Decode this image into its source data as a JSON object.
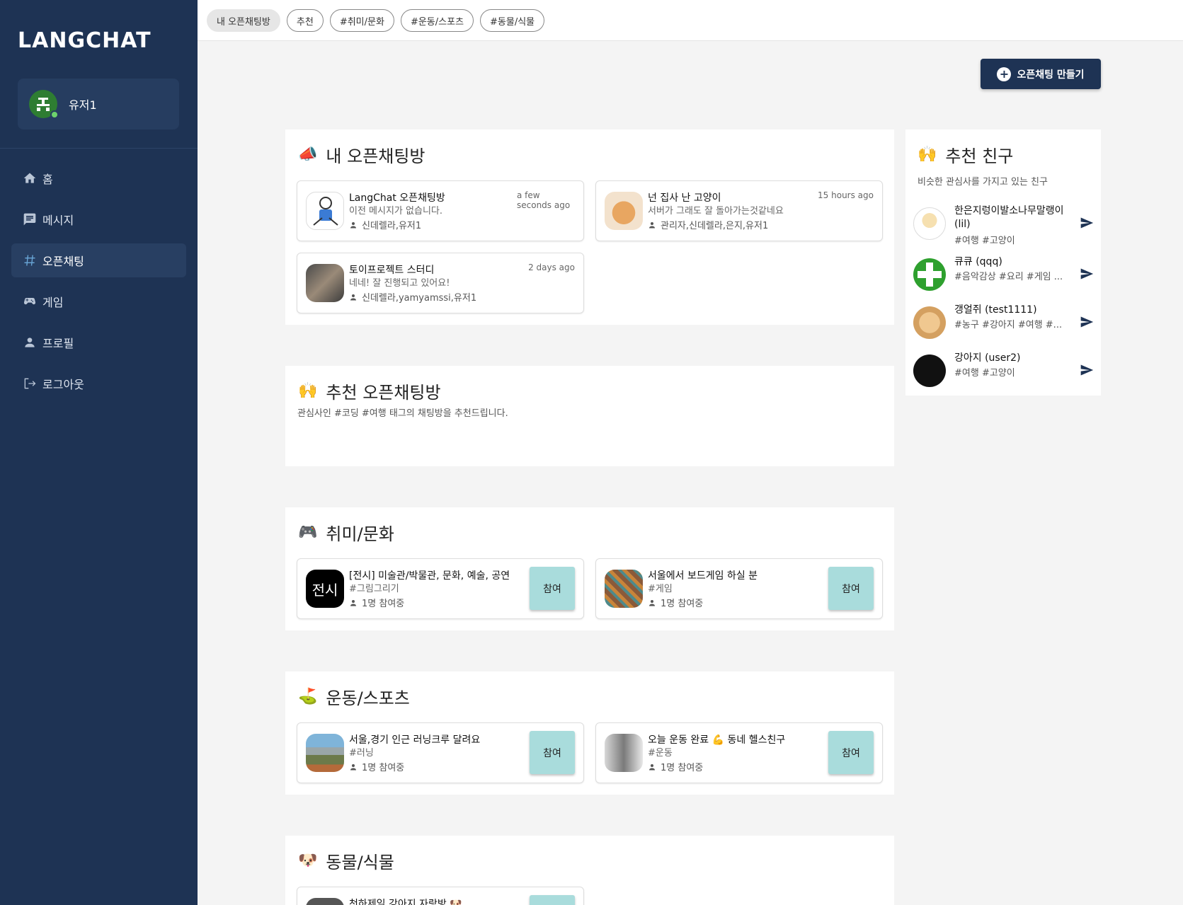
{
  "app": {
    "logo": "LANGCHAT"
  },
  "user": {
    "name": "유저1"
  },
  "nav": [
    {
      "icon": "home-icon",
      "label": "홈"
    },
    {
      "icon": "message-icon",
      "label": "메시지"
    },
    {
      "icon": "hash-icon",
      "label": "오픈채팅",
      "active": true
    },
    {
      "icon": "gamepad-icon",
      "label": "게임"
    },
    {
      "icon": "person-icon",
      "label": "프로필"
    },
    {
      "icon": "logout-icon",
      "label": "로그아웃"
    }
  ],
  "tags": [
    "내 오픈채팅방",
    "추천",
    "#취미/문화",
    "#운동/스포츠",
    "#동물/식물"
  ],
  "create_button": "오픈채팅 만들기",
  "my_rooms": {
    "title": "내 오픈채팅방",
    "rooms": [
      {
        "title": "LangChat 오픈채팅방",
        "message": "이전 메시지가 없습니다.",
        "members": "신데렐라,유저1",
        "time": "a few seconds ago"
      },
      {
        "title": "넌 집사 난 고양이",
        "message": "서버가 그래도 잘 돌아가는것같네요",
        "members": "관리자,신데렐라,은지,유저1",
        "time": "15 hours ago"
      },
      {
        "title": "토이프로젝트 스터디",
        "message": "네네! 잘 진행되고 있어요!",
        "members": "신데렐라,yamyamssi,유저1",
        "time": "2 days ago"
      }
    ]
  },
  "recommend_rooms": {
    "title": "추천 오픈채팅방",
    "subtitle": "관심사인 #코딩 #여행 태그의 채팅방을 추천드립니다."
  },
  "hobby": {
    "title": "취미/문화",
    "rooms": [
      {
        "title": "[전시] 미술관/박물관, 문화, 예술, 공연",
        "tag": "#그림그리기",
        "count": "1명 참여중",
        "thumb_text": "전시"
      },
      {
        "title": "서울에서 보드게임 하실 분",
        "tag": "#게임",
        "count": "1명 참여중"
      }
    ]
  },
  "sports": {
    "title": "운동/스포츠",
    "rooms": [
      {
        "title": "서울,경기 인근 러닝크루 달려요",
        "tag": "#러닝",
        "count": "1명 참여중"
      },
      {
        "title": "오늘 운동 완료 💪 동네 헬스친구",
        "tag": "#운동",
        "count": "1명 참여중"
      }
    ]
  },
  "animal": {
    "title": "동물/식물",
    "rooms": [
      {
        "title": "천하제일 강아지 자랑방 🐶"
      }
    ]
  },
  "join_label": "참여",
  "friends": {
    "title": "추천 친구",
    "subtitle": "비슷한 관심사를 가지고 있는 친구",
    "list": [
      {
        "name": "한은지렁이발소나무말랭이 (lil)",
        "tags": "#여행 #고양이"
      },
      {
        "name": "큐큐 (qqq)",
        "tags": "#음악감상 #요리 #게임 ..."
      },
      {
        "name": "갱얼쥐 (test1111)",
        "tags": "#농구 #강아지 #여행 #..."
      },
      {
        "name": "강아지 (user2)",
        "tags": "#여행 #고양이"
      }
    ]
  },
  "colors": {
    "sidebar": "#1e3354",
    "accent": "#a9dcdc",
    "page_bg": "#f4f4f4"
  }
}
